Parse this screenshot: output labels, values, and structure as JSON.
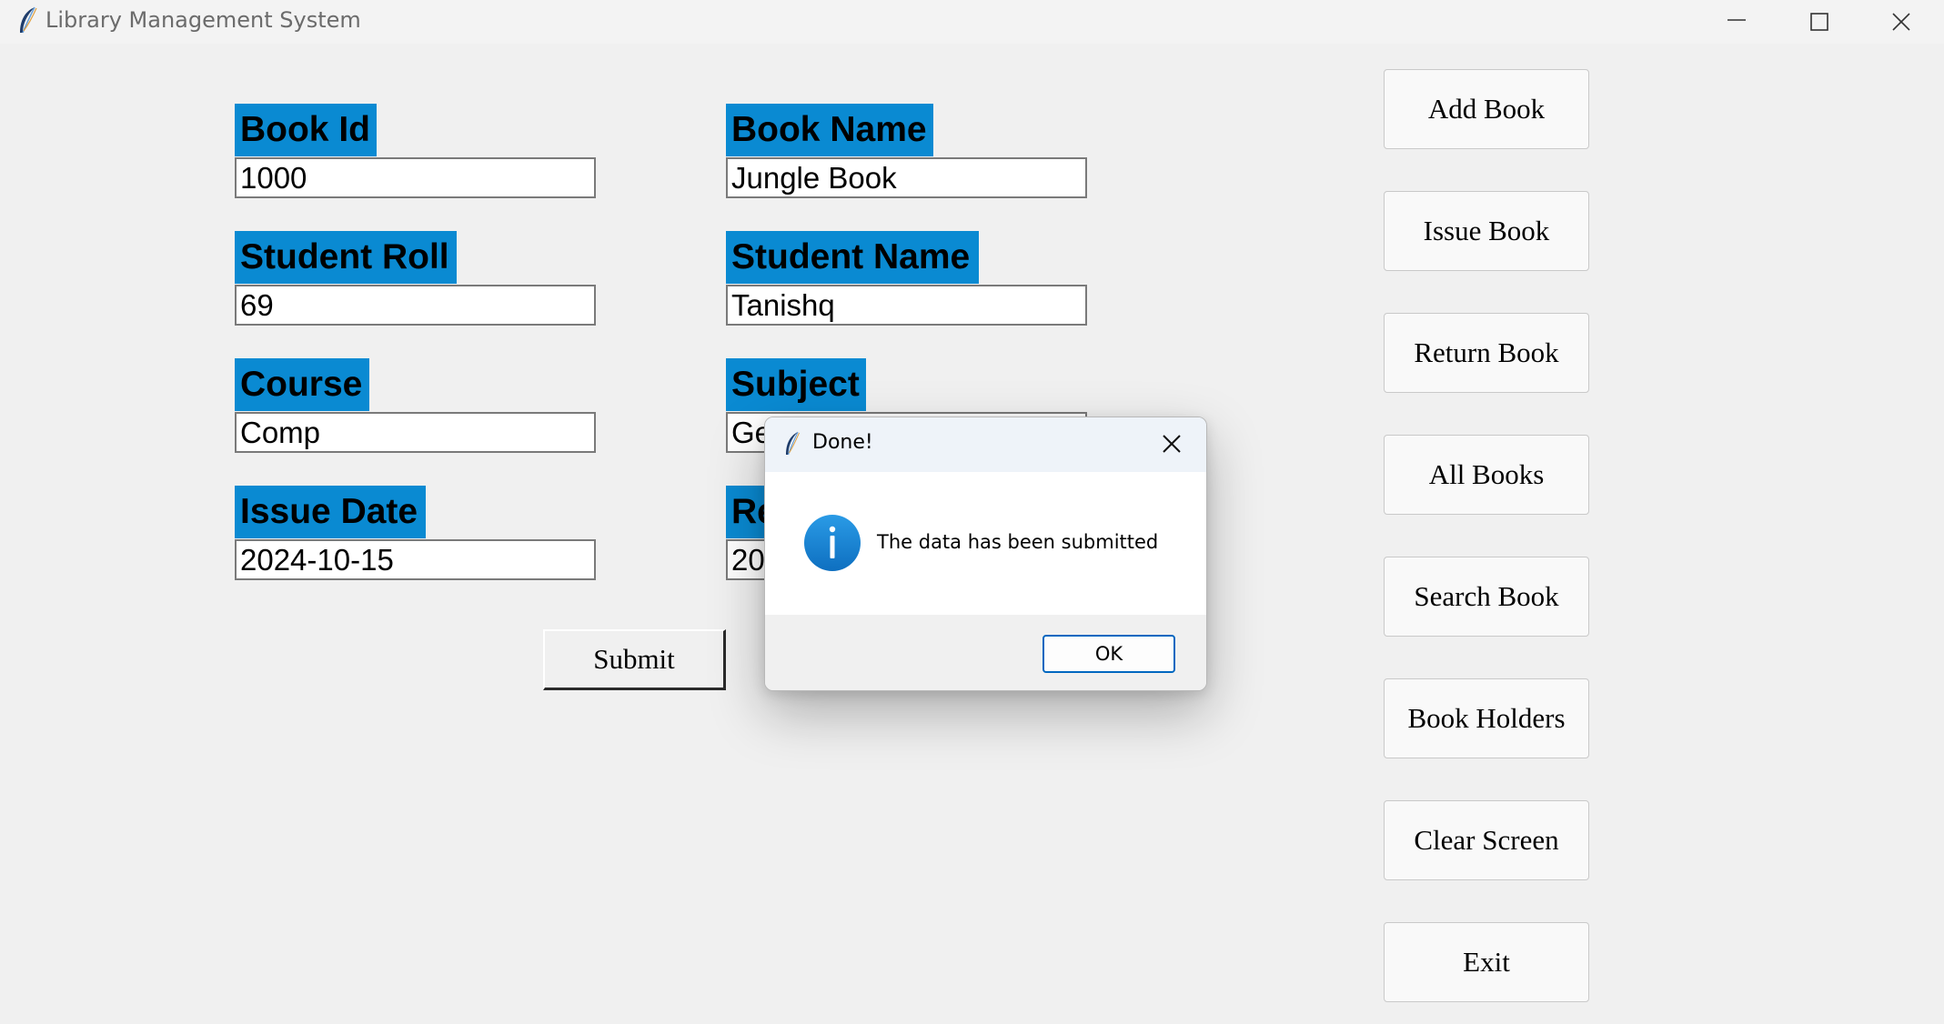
{
  "window": {
    "title": "Library Management System",
    "icon": "feather-icon",
    "controls": [
      "minimize-icon",
      "maximize-icon",
      "close-icon"
    ]
  },
  "form": {
    "book_id": {
      "label": "Book Id",
      "value": "1000"
    },
    "book_name": {
      "label": "Book Name",
      "value": "Jungle Book"
    },
    "student_roll": {
      "label": "Student Roll",
      "value": "69"
    },
    "student_name": {
      "label": "Student Name",
      "value": "Tanishq"
    },
    "course": {
      "label": "Course",
      "value": "Comp"
    },
    "subject": {
      "label": "Subject",
      "value": "Ge"
    },
    "issue_date": {
      "label": "Issue Date",
      "value": "2024-10-15"
    },
    "return_date": {
      "label": "Re",
      "value": "20"
    },
    "submit_label": "Submit"
  },
  "menu": {
    "items": [
      "Add Book",
      "Issue Book",
      "Return Book",
      "All Books",
      "Search Book",
      "Book Holders",
      "Clear Screen",
      "Exit"
    ]
  },
  "dialog": {
    "title": "Done!",
    "message": "The data has been submitted",
    "ok_label": "OK",
    "icon": "info-icon"
  },
  "colors": {
    "label_bg": "#0a8ad2",
    "dialog_ok_border": "#0067c0",
    "info_icon": "#1a86d4"
  }
}
